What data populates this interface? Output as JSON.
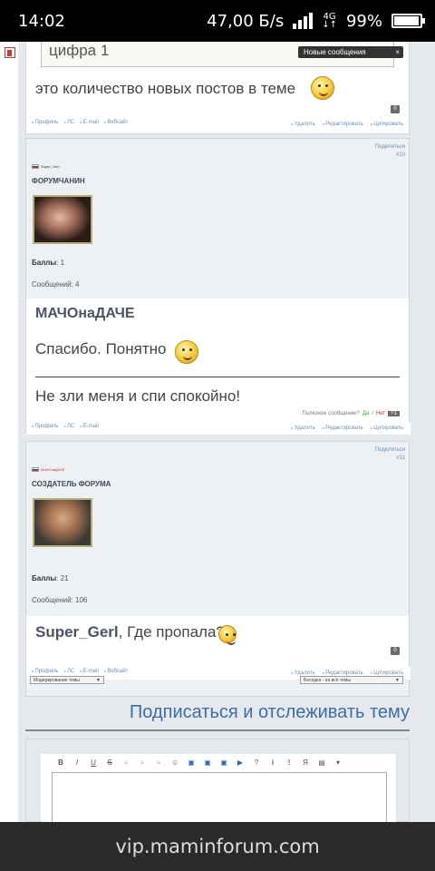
{
  "statusbar": {
    "time": "14:02",
    "speed": "47,00 Б/s",
    "network": "4G",
    "battery": "99%"
  },
  "post_prev": {
    "quote_text": "цифра 1",
    "text": "это количество новых постов в теме",
    "toast_label": "Новые сообщения",
    "toast_close": "×",
    "links_left": [
      "Профиль",
      "ЛС",
      "E-mail",
      "Вебсайт"
    ],
    "links_right": [
      "Удалить",
      "Редактировать",
      "Цитировать"
    ],
    "badge": "0"
  },
  "post10": {
    "share": "Поделиться",
    "num": "#10",
    "nick_small": "Super_Gerl",
    "rank": "ФОРУМЧАНИН",
    "points_label": "Баллы",
    "points_value": ": 1",
    "messages": "Сообщений: 4",
    "username": "МАЧОнаДАЧЕ",
    "text": "Спасибо. Понятно",
    "signature": "Не зли меня и спи спокойно!",
    "useful_q": "Полезное сообщение?",
    "yes": "Да",
    "sep": "/",
    "no": "Нет",
    "count": "+1",
    "links_left": [
      "Профиль",
      "ЛС",
      "E-mail"
    ],
    "links_right": [
      "Удалить",
      "Редактировать",
      "Цитировать"
    ]
  },
  "post11": {
    "share": "Поделиться",
    "num": "#11",
    "nick_small": "МАЧОнаДАЧЕ",
    "rank": "СОЗДАТЕЛЬ ФОРУМА",
    "points_label": "Баллы",
    "points_value": ": 21",
    "messages": "Сообщений: 106",
    "mention": "Super_Gerl",
    "text": ", Где пропала?",
    "badge": "0",
    "links_left": [
      "Профиль",
      "ЛС",
      "E-mail",
      "Вебсайт"
    ],
    "links_right": [
      "Удалить",
      "Редактировать",
      "Цитировать"
    ]
  },
  "bottom": {
    "moderation_select": "Модерирование темы",
    "forum_select": "Беседка - на всё темы",
    "subscribe": "Подписаться и отслеживать тему"
  },
  "editor": {
    "toolbar": [
      "B",
      "I",
      "U",
      "S",
      "≡",
      "≡",
      "≡",
      "☺",
      "▣",
      "▣",
      "▣",
      "▶",
      "?",
      "i",
      "!",
      "Я",
      "▤",
      "▾"
    ]
  },
  "urlbar": {
    "url": "vip.maminforum.com"
  }
}
